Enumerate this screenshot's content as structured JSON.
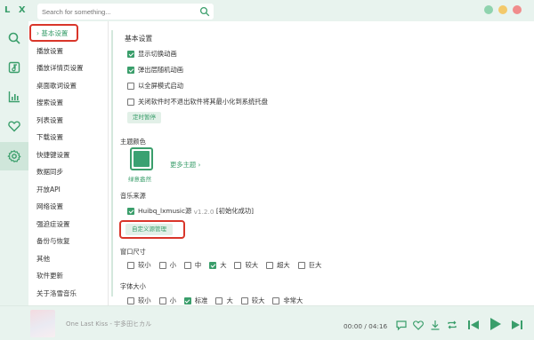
{
  "app": {
    "logo": "L X"
  },
  "search": {
    "placeholder": "Search for something..."
  },
  "sidebar": {
    "items": [
      {
        "label": "› 基本设置",
        "active": true
      },
      {
        "label": "播放设置"
      },
      {
        "label": "播放详情页设置"
      },
      {
        "label": "桌面歌词设置"
      },
      {
        "label": "搜索设置"
      },
      {
        "label": "列表设置"
      },
      {
        "label": "下载设置"
      },
      {
        "label": "快捷键设置"
      },
      {
        "label": "数据同步"
      },
      {
        "label": "开放API"
      },
      {
        "label": "网络设置"
      },
      {
        "label": "强迫症设置"
      },
      {
        "label": "备份与恢复"
      },
      {
        "label": "其他"
      },
      {
        "label": "软件更新"
      },
      {
        "label": "关于洛雪音乐"
      }
    ]
  },
  "basic": {
    "title": "基本设置",
    "options": [
      {
        "label": "显示切换动画",
        "checked": true
      },
      {
        "label": "弹出层随机动画",
        "checked": true
      },
      {
        "label": "以全屏模式启动",
        "checked": false
      },
      {
        "label": "关闭软件时不退出软件将其最小化到系统托盘",
        "checked": false
      }
    ],
    "timer_button": "定时暂停"
  },
  "theme": {
    "title": "主题颜色",
    "current": "绿意盎然",
    "current_color": "#3aa172",
    "more": "更多主题"
  },
  "source": {
    "title": "音乐来源",
    "name": "Huibq_lxmusic源",
    "version": "v1.2.0",
    "status": "[初始化成功]",
    "checked": true,
    "manage_button": "自定义源管理"
  },
  "window_size": {
    "title": "窗口尺寸",
    "options": [
      {
        "label": "较小",
        "checked": false
      },
      {
        "label": "小",
        "checked": false
      },
      {
        "label": "中",
        "checked": false
      },
      {
        "label": "大",
        "checked": true
      },
      {
        "label": "较大",
        "checked": false
      },
      {
        "label": "超大",
        "checked": false
      },
      {
        "label": "巨大",
        "checked": false
      }
    ]
  },
  "font_size": {
    "title": "字体大小",
    "options": [
      {
        "label": "较小",
        "checked": false
      },
      {
        "label": "小",
        "checked": false
      },
      {
        "label": "标准",
        "checked": true
      },
      {
        "label": "大",
        "checked": false
      },
      {
        "label": "较大",
        "checked": false
      },
      {
        "label": "非常大",
        "checked": false
      }
    ]
  },
  "player": {
    "song": "One Last Kiss - 宇多田ヒカル",
    "time": "00:00 / 04:16"
  },
  "colors": {
    "accent": "#3a9e6b",
    "highlight_box": "#d9362a"
  }
}
